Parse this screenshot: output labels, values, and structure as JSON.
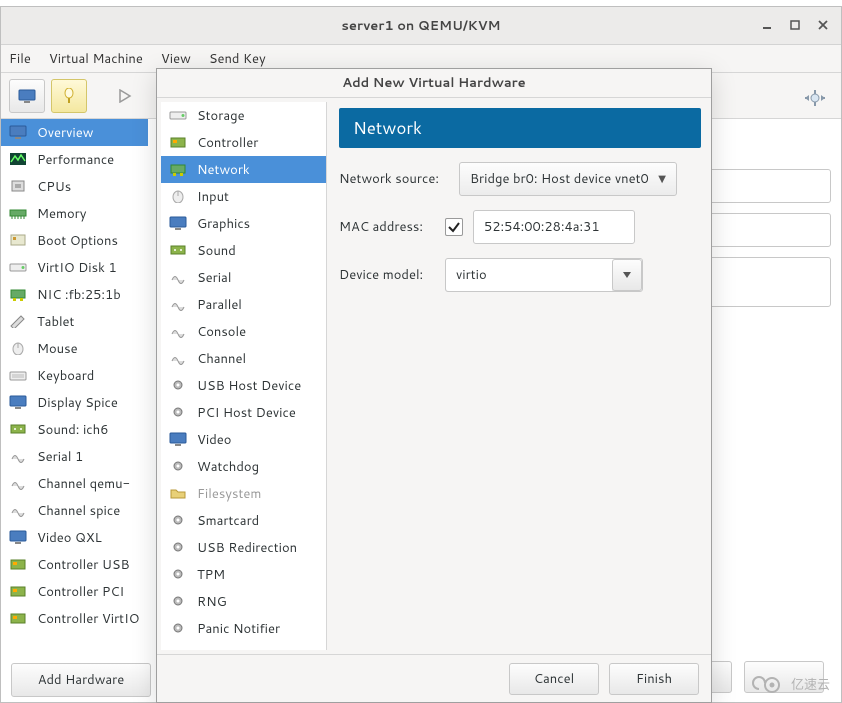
{
  "window": {
    "title": "server1 on QEMU/KVM"
  },
  "menu": [
    "File",
    "Virtual Machine",
    "View",
    "Send Key"
  ],
  "sidebar": [
    {
      "label": "Overview",
      "selected": true
    },
    {
      "label": "Performance"
    },
    {
      "label": "CPUs"
    },
    {
      "label": "Memory"
    },
    {
      "label": "Boot Options"
    },
    {
      "label": "VirtIO Disk 1"
    },
    {
      "label": "NIC :fb:25:1b"
    },
    {
      "label": "Tablet"
    },
    {
      "label": "Mouse"
    },
    {
      "label": "Keyboard"
    },
    {
      "label": "Display Spice"
    },
    {
      "label": "Sound: ich6"
    },
    {
      "label": "Serial 1"
    },
    {
      "label": "Channel qemu-"
    },
    {
      "label": "Channel spice"
    },
    {
      "label": "Video QXL"
    },
    {
      "label": "Controller USB"
    },
    {
      "label": "Controller PCI"
    },
    {
      "label": "Controller VirtIO"
    }
  ],
  "add_hw_btn": "Add Hardware",
  "modal": {
    "title": "Add New Virtual Hardware",
    "hw_list": [
      {
        "label": "Storage"
      },
      {
        "label": "Controller"
      },
      {
        "label": "Network",
        "selected": true
      },
      {
        "label": "Input"
      },
      {
        "label": "Graphics"
      },
      {
        "label": "Sound"
      },
      {
        "label": "Serial"
      },
      {
        "label": "Parallel"
      },
      {
        "label": "Console"
      },
      {
        "label": "Channel"
      },
      {
        "label": "USB Host Device"
      },
      {
        "label": "PCI Host Device"
      },
      {
        "label": "Video"
      },
      {
        "label": "Watchdog"
      },
      {
        "label": "Filesystem",
        "disabled": true
      },
      {
        "label": "Smartcard"
      },
      {
        "label": "USB Redirection"
      },
      {
        "label": "TPM"
      },
      {
        "label": "RNG"
      },
      {
        "label": "Panic Notifier"
      }
    ],
    "form": {
      "header": "Network",
      "netsrc_label": "Network source:",
      "netsrc_value": "Bridge br0: Host device vnet0",
      "mac_label": "MAC address:",
      "mac_value": "52:54:00:28:4a:31",
      "mac_checked": true,
      "model_label": "Device model:",
      "model_value": "virtio"
    },
    "buttons": {
      "cancel": "Cancel",
      "finish": "Finish"
    }
  },
  "watermark": "亿速云"
}
